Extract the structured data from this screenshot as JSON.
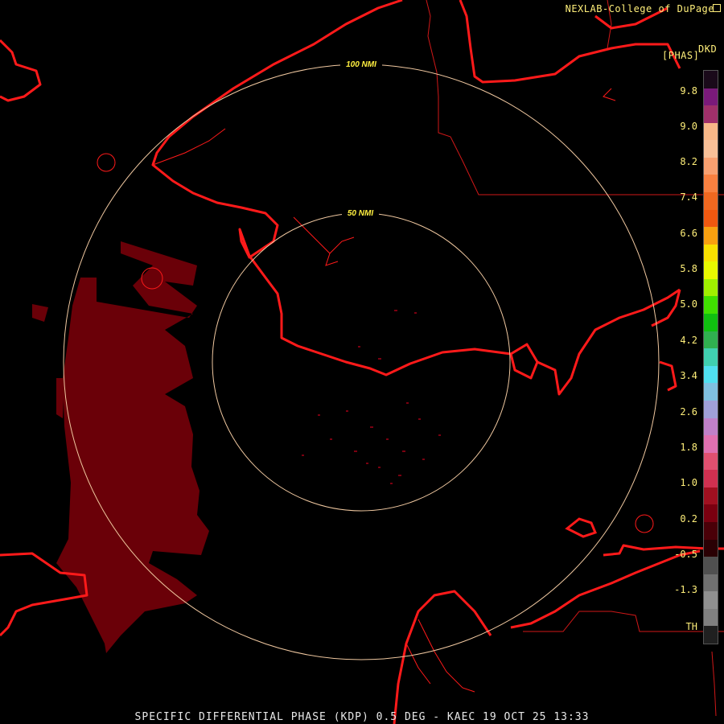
{
  "credit": "NEXLAB-College of DuPage",
  "legend": {
    "product_code": "DKD",
    "units": "[PHAS]",
    "tick_labels": [
      "9.8",
      "9.0",
      "8.2",
      "7.4",
      "6.6",
      "5.8",
      "5.0",
      "4.2",
      "3.4",
      "2.6",
      "1.8",
      "1.0",
      "0.2",
      "-0.5",
      "-1.3",
      "TH"
    ],
    "colors": [
      "#1a0a1a",
      "#7a1a7a",
      "#a0306a",
      "#f8b888",
      "#f8c098",
      "#f8a070",
      "#f88040",
      "#f06820",
      "#f05810",
      "#f8a010",
      "#f8e000",
      "#e8f800",
      "#a0f000",
      "#40e000",
      "#10c010",
      "#30b050",
      "#40d0b0",
      "#50e0f0",
      "#80c0e0",
      "#a0a0d8",
      "#c080c8",
      "#e070b0",
      "#e05070",
      "#d03050",
      "#a01020",
      "#7a0010",
      "#4a0008",
      "#2a0004",
      "#505050",
      "#707070",
      "#909090",
      "#808080",
      "#202020"
    ]
  },
  "range_rings": [
    {
      "label": "100 NMI"
    },
    {
      "label": "50 NMI"
    }
  ],
  "footer": "SPECIFIC DIFFERENTIAL PHASE (KDP) 0.5 DEG - KAEC 19 OCT 25 13:33",
  "colors": {
    "coastline": "#ff1a1a",
    "borders": "#d01818",
    "rings": "#f0c8a0",
    "echo": "#6a0008",
    "text": "#ffef7a"
  }
}
